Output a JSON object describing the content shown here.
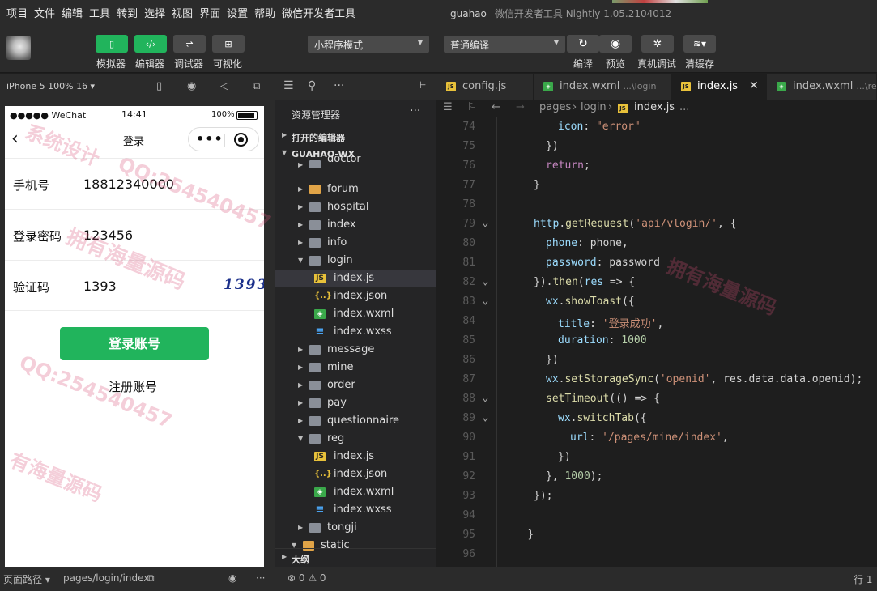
{
  "menubar": {
    "items": [
      "项目",
      "文件",
      "编辑",
      "工具",
      "转到",
      "选择",
      "视图",
      "界面",
      "设置",
      "帮助",
      "微信开发者工具"
    ],
    "project": "guahao",
    "app_title": "微信开发者工具 Nightly 1.05.2104012"
  },
  "toolbar": {
    "simulator": "模拟器",
    "editor": "编辑器",
    "debugger": "调试器",
    "visual": "可视化",
    "mode_select": "小程序模式",
    "compile_select": "普通编译",
    "compile": "编译",
    "preview": "预览",
    "remote_debug": "真机调试",
    "clear_cache": "清缓存",
    "accent_color": "#21b45c"
  },
  "simulator": {
    "device": "iPhone 5 100% 16 ▾",
    "status_carrier": "●●●●● WeChat",
    "status_time": "14:41",
    "status_battery": "100%",
    "nav_title": "登录",
    "phone_label": "手机号",
    "phone_value": "18812340000",
    "password_label": "登录密码",
    "password_value": "123456",
    "code_label": "验证码",
    "code_value": "1393",
    "captcha_text": "1393",
    "login_button": "登录账号",
    "register_link": "注册账号"
  },
  "explorer": {
    "title": "资源管理器",
    "open_editors": "打开的编辑器",
    "project": "GUAHAO-WX",
    "outline": "大纲",
    "tree": [
      {
        "label": "doctor",
        "type": "folder",
        "depth": 1
      },
      {
        "label": "forum",
        "type": "folder-orange",
        "depth": 1
      },
      {
        "label": "hospital",
        "type": "folder",
        "depth": 1
      },
      {
        "label": "index",
        "type": "folder",
        "depth": 1
      },
      {
        "label": "info",
        "type": "folder",
        "depth": 1
      },
      {
        "label": "login",
        "type": "folder-open",
        "depth": 1
      },
      {
        "label": "index.js",
        "type": "js",
        "depth": 2,
        "selected": true
      },
      {
        "label": "index.json",
        "type": "json",
        "depth": 2
      },
      {
        "label": "index.wxml",
        "type": "wxml",
        "depth": 2
      },
      {
        "label": "index.wxss",
        "type": "wxss",
        "depth": 2
      },
      {
        "label": "message",
        "type": "folder",
        "depth": 1
      },
      {
        "label": "mine",
        "type": "folder",
        "depth": 1
      },
      {
        "label": "order",
        "type": "folder",
        "depth": 1
      },
      {
        "label": "pay",
        "type": "folder",
        "depth": 1
      },
      {
        "label": "questionnaire",
        "type": "folder",
        "depth": 1
      },
      {
        "label": "reg",
        "type": "folder-open",
        "depth": 1
      },
      {
        "label": "index.js",
        "type": "js",
        "depth": 2
      },
      {
        "label": "index.json",
        "type": "json",
        "depth": 2
      },
      {
        "label": "index.wxml",
        "type": "wxml",
        "depth": 2
      },
      {
        "label": "index.wxss",
        "type": "wxss",
        "depth": 2
      },
      {
        "label": "tongji",
        "type": "folder",
        "depth": 1
      },
      {
        "label": "static",
        "type": "folder-orange-open",
        "depth": 0
      }
    ]
  },
  "tabs": [
    {
      "label": "config.js",
      "sub": "",
      "icon": "js"
    },
    {
      "label": "index.wxml",
      "sub": "...\\login",
      "icon": "wxml"
    },
    {
      "label": "index.js",
      "sub": "",
      "icon": "js",
      "active": true
    },
    {
      "label": "index.wxml",
      "sub": "...\\reg",
      "icon": "wxml"
    }
  ],
  "breadcrumb": [
    "pages",
    "login",
    "index.js",
    "..."
  ],
  "code": [
    {
      "n": "74",
      "fold": false,
      "indent": 3,
      "tokens": [
        [
          "v",
          "icon"
        ],
        [
          "p",
          ": "
        ],
        [
          "s",
          "\"error\""
        ]
      ]
    },
    {
      "n": "75",
      "fold": false,
      "indent": 2,
      "tokens": [
        [
          "p",
          "})"
        ]
      ]
    },
    {
      "n": "76",
      "fold": false,
      "indent": 2,
      "tokens": [
        [
          "k",
          "return"
        ],
        [
          "p",
          ";"
        ]
      ]
    },
    {
      "n": "77",
      "fold": false,
      "indent": 1,
      "tokens": [
        [
          "p",
          "}"
        ]
      ]
    },
    {
      "n": "78",
      "fold": false,
      "indent": 0,
      "tokens": []
    },
    {
      "n": "79",
      "fold": true,
      "indent": 1,
      "tokens": [
        [
          "v",
          "http"
        ],
        [
          "p",
          "."
        ],
        [
          "f",
          "getRequest"
        ],
        [
          "p",
          "("
        ],
        [
          "s",
          "'api/vlogin/'"
        ],
        [
          "p",
          ", {"
        ]
      ]
    },
    {
      "n": "80",
      "fold": false,
      "indent": 2,
      "tokens": [
        [
          "v",
          "phone"
        ],
        [
          "p",
          ": phone,"
        ]
      ]
    },
    {
      "n": "81",
      "fold": false,
      "indent": 2,
      "tokens": [
        [
          "v",
          "password"
        ],
        [
          "p",
          ": password"
        ]
      ]
    },
    {
      "n": "82",
      "fold": true,
      "indent": 1,
      "tokens": [
        [
          "p",
          "})."
        ],
        [
          "f",
          "then"
        ],
        [
          "p",
          "("
        ],
        [
          "v",
          "res"
        ],
        [
          "p",
          " => {"
        ]
      ]
    },
    {
      "n": "83",
      "fold": true,
      "indent": 2,
      "tokens": [
        [
          "v",
          "wx"
        ],
        [
          "p",
          "."
        ],
        [
          "f",
          "showToast"
        ],
        [
          "p",
          "({"
        ]
      ]
    },
    {
      "n": "84",
      "fold": false,
      "indent": 3,
      "tokens": [
        [
          "v",
          "title"
        ],
        [
          "p",
          ": "
        ],
        [
          "s",
          "'登录成功'"
        ],
        [
          "p",
          ","
        ]
      ]
    },
    {
      "n": "85",
      "fold": false,
      "indent": 3,
      "tokens": [
        [
          "v",
          "duration"
        ],
        [
          "p",
          ": "
        ],
        [
          "n",
          "1000"
        ]
      ]
    },
    {
      "n": "86",
      "fold": false,
      "indent": 2,
      "tokens": [
        [
          "p",
          "})"
        ]
      ]
    },
    {
      "n": "87",
      "fold": false,
      "indent": 2,
      "tokens": [
        [
          "v",
          "wx"
        ],
        [
          "p",
          "."
        ],
        [
          "f",
          "setStorageSync"
        ],
        [
          "p",
          "("
        ],
        [
          "s",
          "'openid'"
        ],
        [
          "p",
          ", res.data.data.openid);"
        ]
      ]
    },
    {
      "n": "88",
      "fold": true,
      "indent": 2,
      "tokens": [
        [
          "f",
          "setTimeout"
        ],
        [
          "p",
          "(() => {"
        ]
      ]
    },
    {
      "n": "89",
      "fold": true,
      "indent": 3,
      "tokens": [
        [
          "v",
          "wx"
        ],
        [
          "p",
          "."
        ],
        [
          "f",
          "switchTab"
        ],
        [
          "p",
          "({"
        ]
      ]
    },
    {
      "n": "90",
      "fold": false,
      "indent": 4,
      "tokens": [
        [
          "v",
          "url"
        ],
        [
          "p",
          ": "
        ],
        [
          "s",
          "'/pages/mine/index'"
        ],
        [
          "p",
          ","
        ]
      ]
    },
    {
      "n": "91",
      "fold": false,
      "indent": 3,
      "tokens": [
        [
          "p",
          "})"
        ]
      ]
    },
    {
      "n": "92",
      "fold": false,
      "indent": 2,
      "tokens": [
        [
          "p",
          "}, "
        ],
        [
          "n",
          "1000"
        ],
        [
          "p",
          ");"
        ]
      ]
    },
    {
      "n": "93",
      "fold": false,
      "indent": 1,
      "tokens": [
        [
          "p",
          "});"
        ]
      ]
    },
    {
      "n": "94",
      "fold": false,
      "indent": 0,
      "tokens": []
    },
    {
      "n": "95",
      "fold": false,
      "indent": 0.5,
      "tokens": [
        [
          "p",
          "}"
        ]
      ]
    },
    {
      "n": "96",
      "fold": false,
      "indent": 0,
      "tokens": []
    }
  ],
  "statusbar": {
    "page_path_label": "页面路径 ▾",
    "page_path": "pages/login/index",
    "problems": "⊗ 0 ⚠ 0",
    "cursor": "行 1"
  },
  "watermarks": [
    "拥有海量源码",
    "QQ:254540457",
    "系统设计",
    "拥有海量源码",
    "QQ:254540457",
    "有海量源码"
  ]
}
